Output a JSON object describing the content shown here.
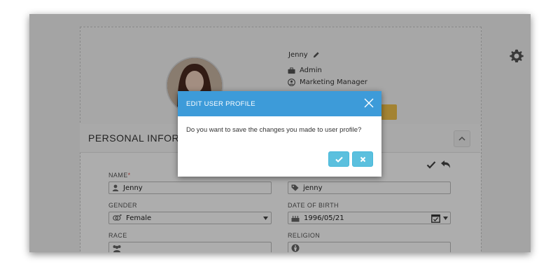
{
  "profile": {
    "name": "Jenny",
    "role": "Admin",
    "title": "Marketing Manager"
  },
  "section": {
    "title": "PERSONAL INFORMATION"
  },
  "form": {
    "name_label": "NAME",
    "name_required": "*",
    "name_value": "Jenny",
    "nickname_value": "jenny",
    "gender_label": "GENDER",
    "gender_value": "Female",
    "dob_label": "DATE OF BIRTH",
    "dob_value": "1996/05/21",
    "race_label": "RACE",
    "religion_label": "RELIGION"
  },
  "dialog": {
    "title": "EDIT USER PROFILE",
    "message": "Do you want to save the changes you made to user profile?"
  },
  "colors": {
    "dialog_header": "#3d9bd9",
    "button_info": "#5bc0de",
    "accent_yellow": "#f0c24b",
    "required_red": "#d9534f"
  }
}
